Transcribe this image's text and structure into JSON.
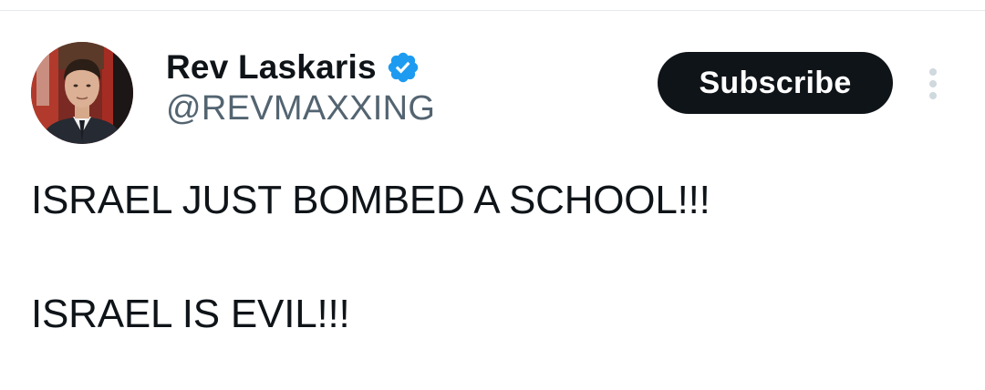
{
  "author": {
    "display_name": "Rev Laskaris",
    "handle": "@REVMAXXING",
    "verified": true
  },
  "actions": {
    "subscribe_label": "Subscribe"
  },
  "tweet": {
    "lines": [
      "ISRAEL JUST BOMBED A SCHOOL!!!",
      "ISRAEL IS EVIL!!!"
    ]
  },
  "icons": {
    "verified": "verified-badge-icon",
    "more": "more-vertical-icon"
  },
  "colors": {
    "verified_blue": "#1d9bf0",
    "subscribe_bg": "#0f1419",
    "handle_gray": "#536471",
    "more_dots": "#cfd9de"
  }
}
